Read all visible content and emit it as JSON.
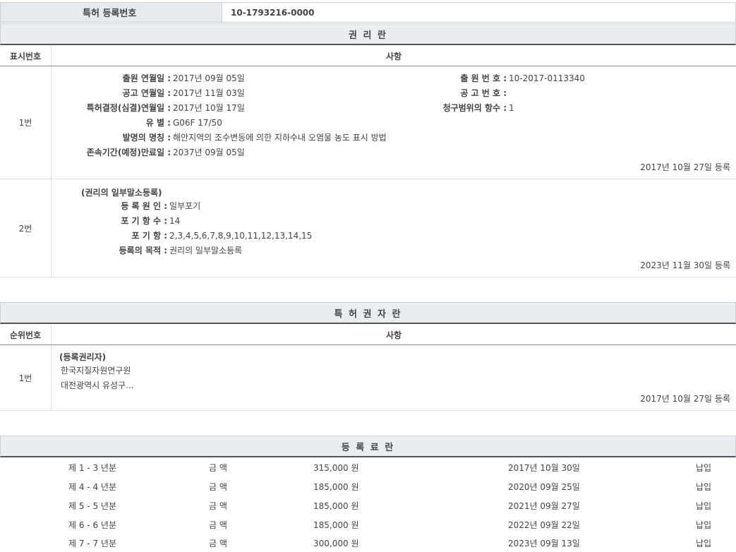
{
  "patent_reg": {
    "label": "특허 등록번호",
    "value": "10-1793216-0000"
  },
  "rights_section": {
    "title": "권 리 란",
    "col_num": "표시번호",
    "col_content": "사항",
    "rows": [
      {
        "num": "1번",
        "left_fields": [
          {
            "key": "출원 연월일 :",
            "value": "2017년 09월 05일"
          },
          {
            "key": "공고 연월일 :",
            "value": "2017년 11월 03일"
          },
          {
            "key": "특허결정(심결)연월일 :",
            "value": "2017년 10월 17일"
          },
          {
            "key": "유 별 :",
            "value": "G06F 17/50"
          },
          {
            "key": "발명의 명칭 :",
            "value": "해안지역의 조수변동에 의한 지하수내 오염물 농도 표시 방법"
          },
          {
            "key": "존속기간(예정)만료일 :",
            "value": "2037년 09월 05일"
          }
        ],
        "right_fields": [
          {
            "key": "출 원 번 호 :",
            "value": "10-2017-0113340"
          },
          {
            "key": "공 고 번 호 :",
            "value": ""
          },
          {
            "key": "청구범위의 항수 :",
            "value": "1"
          }
        ],
        "reg_date": "2017년 10월 27일 등록"
      },
      {
        "num": "2번",
        "sub_title": "(권리의 일부말소등록)",
        "left_fields": [
          {
            "key": "등 록 원 인 :",
            "value": "일부포기"
          },
          {
            "key": "포 기 항 수 :",
            "value": "14"
          },
          {
            "key": "포 기 항 :",
            "value": "2,3,4,5,6,7,8,9,10,11,12,13,14,15"
          },
          {
            "key": "등록의 목적 :",
            "value": "권리의 일부말소등록"
          }
        ],
        "reg_date": "2023년 11월 30일 등록"
      }
    ]
  },
  "holder_section": {
    "title": "특 허 권 자 란",
    "col_num": "순위번호",
    "col_content": "사항",
    "rows": [
      {
        "num": "1번",
        "sub_title": "(등록권리자)",
        "lines": [
          "한국지질자원연구원",
          "대전광역시 유성구..."
        ],
        "reg_date": "2017년 10월 27일 등록"
      }
    ]
  },
  "fee_section": {
    "title": "등 록 료 란",
    "rows": [
      {
        "period": "제 1 - 3 년분",
        "label": "금 액",
        "amount": "315,000 원",
        "date": "2017년 10월 30일",
        "status": "납입"
      },
      {
        "period": "제 4 - 4 년분",
        "label": "금 액",
        "amount": "185,000 원",
        "date": "2020년 09월 25일",
        "status": "납입"
      },
      {
        "period": "제 5 - 5 년분",
        "label": "금 액",
        "amount": "185,000 원",
        "date": "2021년 09월 27일",
        "status": "납입"
      },
      {
        "period": "제 6 - 6 년분",
        "label": "금 액",
        "amount": "185,000 원",
        "date": "2022년 09월 22일",
        "status": "납입"
      },
      {
        "period": "제 7 - 7 년분",
        "label": "금 액",
        "amount": "300,000 원",
        "date": "2023년 09월 13일",
        "status": "납입"
      }
    ]
  }
}
